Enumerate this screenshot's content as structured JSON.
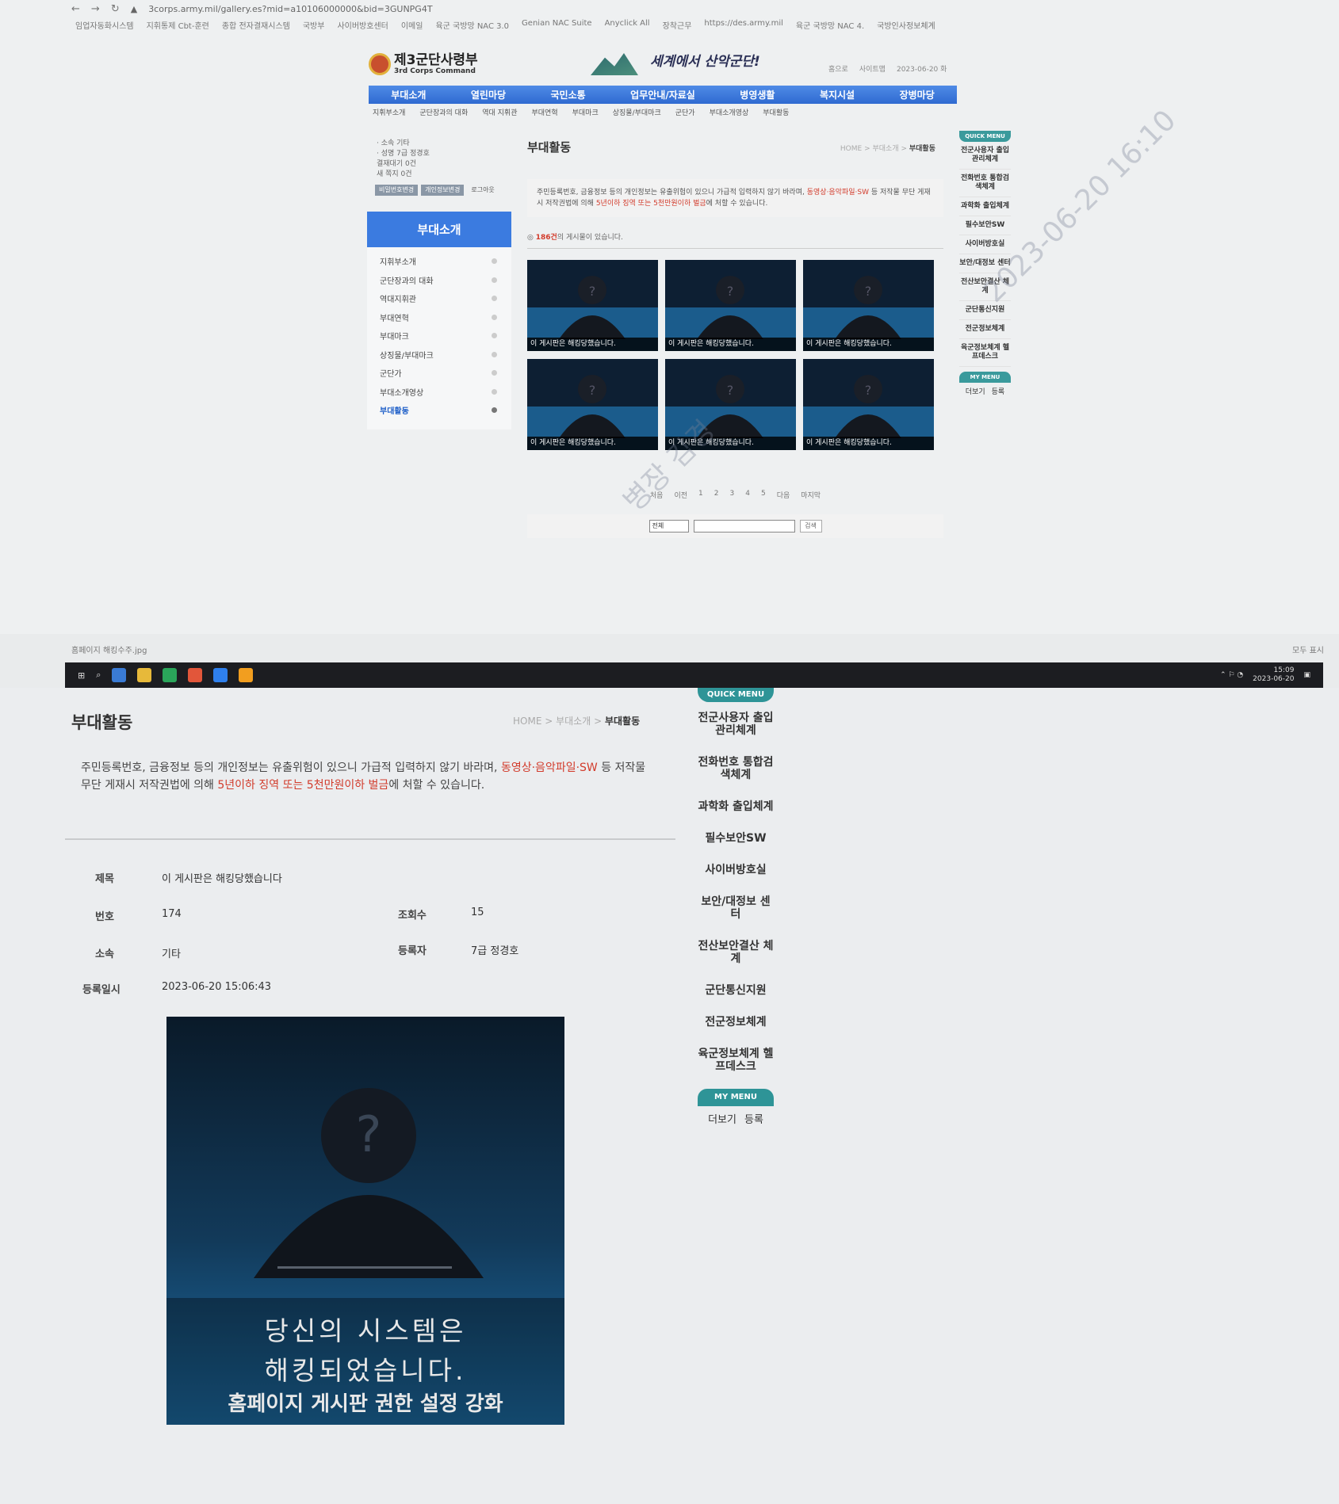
{
  "browser": {
    "url": "3corps.army.mil/gallery.es?mid=a10106000000&bid=3GUNPG4T",
    "bookmarks": [
      "임업자동화시스템",
      "지휘통제 Cbt-훈련",
      "종합 전자결재시스템",
      "국방부",
      "사이버방호센터",
      "이메일",
      "육군 국방망 NAC 3.0",
      "Genian NAC Suite",
      "Anyclick All",
      "장착근무",
      "https://des.army.mil",
      "육군 국방망 NAC 4.",
      "국방인사정보체계"
    ]
  },
  "site": {
    "logo_title": "제3군단사령부",
    "logo_subtitle": "3rd Corps Command",
    "slogan": "세계에서 산악군단!",
    "util_links": [
      "홈으로",
      "사이트맵",
      "2023-06-20 화"
    ],
    "gnb": [
      "부대소개",
      "열린마당",
      "국민소통",
      "업무안내/자료실",
      "병영생활",
      "복지시설",
      "장병마당"
    ],
    "sub_gnb": [
      "지휘부소개",
      "군단장과의 대화",
      "역대 지휘관",
      "부대연혁",
      "부대마크",
      "상징물/부대마크",
      "군단가",
      "부대소개영상",
      "부대활동"
    ]
  },
  "login": {
    "lines": [
      "· 소속  기타",
      "· 성명  7급 정경호",
      "  결재대기 0건",
      "  새 쪽지 0건"
    ],
    "buttons": [
      "비밀번호변경",
      "개인정보변경",
      "로그아웃"
    ]
  },
  "lnb": {
    "title": "부대소개",
    "items": [
      "지휘부소개",
      "군단장과의 대화",
      "역대지휘관",
      "부대연혁",
      "부대마크",
      "상징물/부대마크",
      "군단가",
      "부대소개영상",
      "부대활동"
    ]
  },
  "content": {
    "title": "부대활동",
    "crumb": [
      "HOME",
      "부대소개",
      "부대활동"
    ],
    "notice_pre": "주민등록번호, 금융정보 등의 개인정보는 유출위험이 있으니 가급적 입력하지 않기 바라며, ",
    "notice_red1": "동영상·음악파일·SW",
    "notice_mid": " 등 저작물 무단 게재시 저작권법에 의해 ",
    "notice_red2": "5년이하 징역 또는 5천만원이하 벌금",
    "notice_post": "에 처할 수 있습니다.",
    "count_red": "186건",
    "count_text": "의 게시물이 있습니다.",
    "thumb_caption": "이 게시판은 해킹당했습니다.",
    "pager": [
      "처음",
      "이전",
      "1",
      "2",
      "3",
      "4",
      "5",
      "다음",
      "마지막"
    ],
    "search_select": "전체",
    "search_button": "검색"
  },
  "quick_menu": {
    "head": "QUICK MENU",
    "items": [
      "전군사용자 출입관리체계",
      "전화번호 통합검색체계",
      "과학화 출입체계",
      "필수보안SW",
      "사이버방호실",
      "보안/대정보 센터",
      "전산보안결산 체계",
      "군단통신지원",
      "전군정보체계",
      "육군정보체계 헬프데스크"
    ],
    "my_menu_head": "MY MENU",
    "my_menu_items": [
      "더보기",
      "등록"
    ]
  },
  "watermark": {
    "timestamp": "2023-06-20 16:10",
    "name": "병장 김경"
  },
  "download_bar": {
    "file": "홈페이지 해킹수주.jpg",
    "show_all": "모두 표시"
  },
  "taskbar": {
    "time": "15:09",
    "date": "2023-06-20"
  },
  "detail": {
    "title": "부대활동",
    "crumb": [
      "HOME",
      "부대소개",
      "부대활동"
    ],
    "labels": {
      "subject": "제목",
      "number": "번호",
      "views": "조회수",
      "unit": "소속",
      "author": "등록자",
      "date": "등록일시"
    },
    "values": {
      "subject": "이 게시판은 해킹당했습니다",
      "number": "174",
      "views": "15",
      "unit": "기타",
      "author": "7급 정경호",
      "date": "2023-06-20 15:06:43"
    },
    "image_caption": [
      "당신의 시스템은",
      "해킹되었습니다.",
      "홈페이지 게시판 권한 설정 강화"
    ]
  }
}
